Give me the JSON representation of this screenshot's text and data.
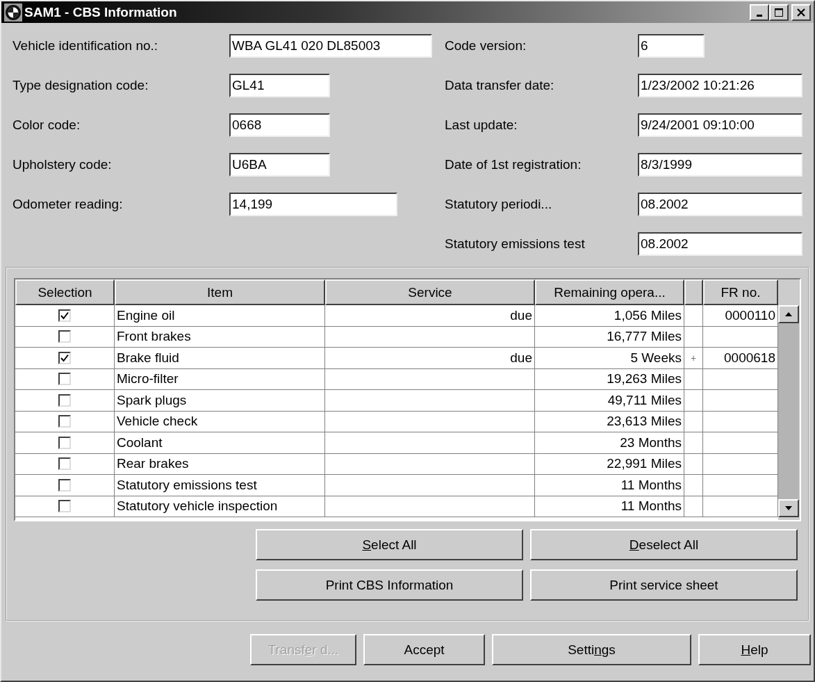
{
  "window": {
    "title": "SAM1 - CBS Information"
  },
  "left_fields": [
    {
      "label": "Vehicle identification no.:",
      "value": "WBA GL41 020 DL85003"
    },
    {
      "label": "Type designation code:",
      "value": "GL41"
    },
    {
      "label": "Color code:",
      "value": "0668"
    },
    {
      "label": "Upholstery code:",
      "value": "U6BA"
    },
    {
      "label": "Odometer reading:",
      "value": "14,199"
    }
  ],
  "right_fields": [
    {
      "label": "Code version:",
      "value": "6"
    },
    {
      "label": "Data transfer date:",
      "value": "1/23/2002 10:21:26"
    },
    {
      "label": "Last update:",
      "value": "9/24/2001 09:10:00"
    },
    {
      "label": "Date of 1st registration:",
      "value": "8/3/1999"
    },
    {
      "label": "Statutory periodi...",
      "value": "08.2002"
    },
    {
      "label": "Statutory emissions test",
      "value": "08.2002"
    }
  ],
  "table": {
    "columns": [
      {
        "kind": "text",
        "label": "Selection"
      },
      {
        "kind": "text",
        "label": "Item"
      },
      {
        "kind": "text",
        "label": "Service"
      },
      {
        "kind": "text",
        "label": "Remaining opera..."
      },
      {
        "kind": "blank"
      },
      {
        "kind": "text",
        "label": "FR no."
      }
    ],
    "rows": [
      {
        "checked": true,
        "item": "Engine oil",
        "service": "due",
        "remaining": "1,056 Miles",
        "fr_no": "0000110"
      },
      {
        "checked": false,
        "item": "Front brakes",
        "remaining": "16,777 Miles"
      },
      {
        "checked": true,
        "item": "Brake fluid",
        "service": "due",
        "remaining": "5 Weeks",
        "flag": "+",
        "fr_no": "0000618"
      },
      {
        "checked": false,
        "item": "Micro-filter",
        "remaining": "19,263 Miles"
      },
      {
        "checked": false,
        "item": "Spark plugs",
        "remaining": "49,711 Miles"
      },
      {
        "checked": false,
        "item": "Vehicle check",
        "remaining": "23,613 Miles"
      },
      {
        "checked": false,
        "item": "Coolant",
        "remaining": "23 Months"
      },
      {
        "checked": false,
        "item": "Rear brakes",
        "remaining": "22,991 Miles"
      },
      {
        "checked": false,
        "item": "Statutory emissions test",
        "remaining": "11 Months"
      },
      {
        "checked": false,
        "item": "Statutory vehicle inspection",
        "remaining": "11 Months"
      }
    ]
  },
  "table_buttons": [
    {
      "key": "S",
      "after": "elect All",
      "disabled": false
    },
    {
      "key": "D",
      "after": "eselect All",
      "disabled": false
    },
    {
      "label": "Print CBS Information",
      "disabled": false
    },
    {
      "label": "Print service sheet",
      "disabled": false
    }
  ],
  "footer_buttons": [
    {
      "before": "Transf",
      "key": "e",
      "after": "r d...",
      "disabled": true
    },
    {
      "label": "Accept",
      "disabled": false
    },
    {
      "before": "Setti",
      "key": "n",
      "after": "gs",
      "disabled": false
    },
    {
      "key": "H",
      "after": "elp",
      "disabled": false
    }
  ]
}
